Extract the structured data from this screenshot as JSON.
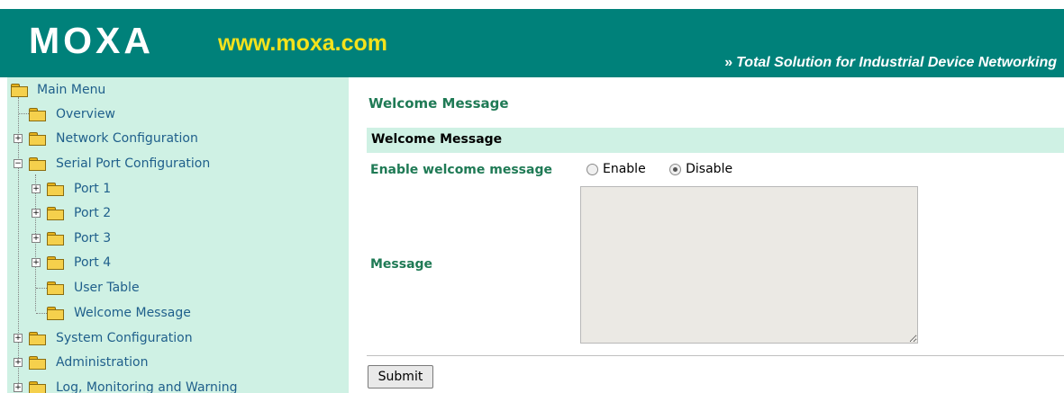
{
  "header": {
    "logo": "MOXA",
    "url": "www.moxa.com",
    "tagline_icon": "double-chevron-right-icon",
    "tagline": "Total Solution for Industrial Device Networking",
    "colors": {
      "brand_green": "#00817a",
      "url_yellow": "#f4e21c"
    }
  },
  "sidebar": {
    "root": "Main Menu",
    "items": [
      {
        "label": "Overview"
      },
      {
        "label": "Network Configuration"
      },
      {
        "label": "Serial Port Configuration"
      },
      {
        "label": "Port 1"
      },
      {
        "label": "Port 2"
      },
      {
        "label": "Port 3"
      },
      {
        "label": "Port 4"
      },
      {
        "label": "User Table"
      },
      {
        "label": "Welcome Message"
      },
      {
        "label": "System Configuration"
      },
      {
        "label": "Administration"
      },
      {
        "label": "Log, Monitoring and Warning"
      }
    ],
    "colors": {
      "background": "#cff1e4",
      "link": "#1f5f8b"
    }
  },
  "main": {
    "title": "Welcome Message",
    "section_header": "Welcome Message",
    "enable_label": "Enable welcome message",
    "radio_enable": "Enable",
    "radio_disable": "Disable",
    "selected_option": "Disable",
    "message_label": "Message",
    "message_value": "",
    "submit": "Submit",
    "colors": {
      "label_green": "#1f7a55"
    }
  }
}
